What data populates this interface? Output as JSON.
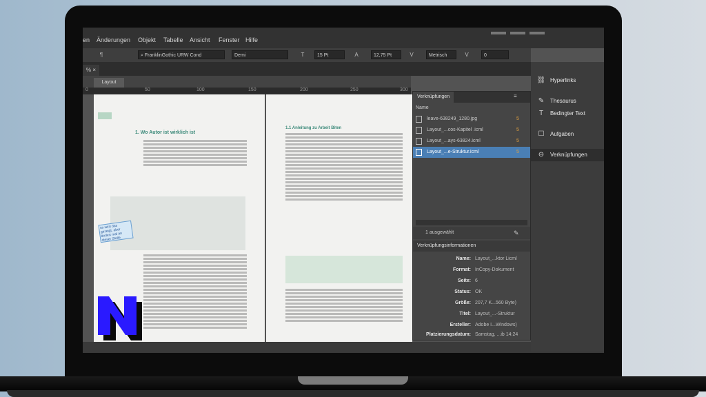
{
  "menu": [
    "en",
    "Änderungen",
    "Objekt",
    "Tabelle",
    "Ansicht",
    "Fenster",
    "Hilfe"
  ],
  "toolbar": {
    "font": "FranklinGothic URW Cond",
    "style": "Demi",
    "size": "15 Pt",
    "leading": "12,75 Pt",
    "kerning": "Metrisch",
    "tracking": "0"
  },
  "document": {
    "tab": "%",
    "layout_label": "Layout",
    "ruler": [
      "0",
      "50",
      "100",
      "150",
      "200",
      "250",
      "300"
    ],
    "left_heading": "1. Wo Autor ist wirklich ist",
    "highlight": "Autor ist wirklich",
    "right_heading": "1.1 Anleitung zu Arbeit Biten",
    "sticky_note": "so wird das gezeigt, aber ändert mal an dieser Stelle."
  },
  "links_panel": {
    "title": "Verknüpfungen",
    "column": "Name",
    "items": [
      {
        "name": "leave-638249_1280.jpg",
        "page": "5"
      },
      {
        "name": "Layout_...cos-Kapitel .icml",
        "page": "5"
      },
      {
        "name": "Layout_...ays-63824.icml",
        "page": "5"
      },
      {
        "name": "Layout_...e-Struktur.icml",
        "page": "5"
      }
    ],
    "selected_text": "1 ausgewählt",
    "info_title": "Verknüpfungsinformationen",
    "info": [
      {
        "k": "Name:",
        "v": "Layout_...ktor Licml"
      },
      {
        "k": "Format:",
        "v": "InCopy-Dokument"
      },
      {
        "k": "Seite:",
        "v": "6"
      },
      {
        "k": "Status:",
        "v": "OK"
      },
      {
        "k": "Größe:",
        "v": "207,7 K...560 Byte)"
      },
      {
        "k": "Titel:",
        "v": "Layout_...-Struktur"
      },
      {
        "k": "Ersteller:",
        "v": "Adobe I...Windows)"
      },
      {
        "k": "Platzierungsdatum:",
        "v": "Samstag, ...ib 14:24"
      }
    ]
  },
  "side_panel": [
    {
      "icon": "hyperlinks-icon",
      "label": "Hyperlinks"
    },
    {
      "icon": "thesaurus-icon",
      "label": "Thesaurus"
    },
    {
      "icon": "conditional-text-icon",
      "label": "Bedingter Text"
    },
    {
      "icon": "tasks-icon",
      "label": "Aufgaben"
    },
    {
      "icon": "links-icon",
      "label": "Verknüpfungen"
    }
  ],
  "colors": {
    "accent": "#4a7fb5",
    "highlight": "#c02a4a",
    "logo": "#2a1aff"
  }
}
